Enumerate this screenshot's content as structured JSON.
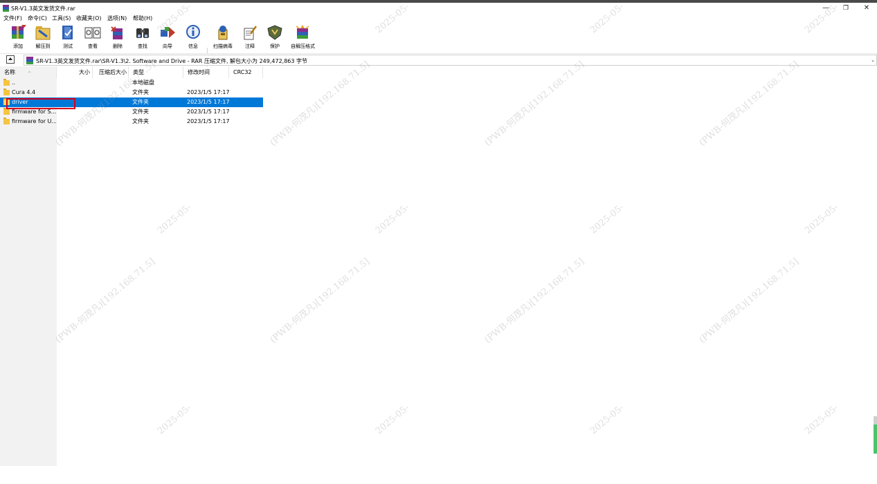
{
  "window": {
    "title": "SR-V1.3英文发货文件.rar",
    "controls": {
      "minimize": "—",
      "maximize": "❐",
      "close": "✕"
    }
  },
  "menu": {
    "items": [
      "文件(F)",
      "命令(C)",
      "工具(S)",
      "收藏夹(O)",
      "选项(N)",
      "帮助(H)"
    ]
  },
  "toolbar": {
    "buttons": [
      {
        "label": "添加",
        "icon": "add-archive-icon"
      },
      {
        "label": "解压到",
        "icon": "extract-to-icon"
      },
      {
        "label": "测试",
        "icon": "test-icon"
      },
      {
        "label": "查看",
        "icon": "view-icon"
      },
      {
        "label": "删除",
        "icon": "delete-icon"
      },
      {
        "label": "查找",
        "icon": "find-icon"
      },
      {
        "label": "向导",
        "icon": "wizard-icon"
      },
      {
        "label": "信息",
        "icon": "info-icon"
      },
      {
        "label": "扫描病毒",
        "icon": "virus-scan-icon"
      },
      {
        "label": "注释",
        "icon": "comment-icon"
      },
      {
        "label": "保护",
        "icon": "protect-icon"
      },
      {
        "label": "自解压格式",
        "icon": "sfx-icon"
      }
    ]
  },
  "address": {
    "path": "SR-V1.3英文发货文件.rar\\SR-V1.3\\2. Software and Drive - RAR 压缩文件, 解包大小为 249,472,863 字节"
  },
  "columns": {
    "name": "名称",
    "size": "大小",
    "packed": "压缩后大小",
    "type": "类型",
    "modified": "修改时间",
    "crc": "CRC32"
  },
  "rows": [
    {
      "name": "..",
      "type": "本地磁盘",
      "modified": "",
      "selected": false
    },
    {
      "name": "Cura 4.4",
      "type": "文件夹",
      "modified": "2023/1/5 17:17",
      "selected": false
    },
    {
      "name": "driver",
      "type": "文件夹",
      "modified": "2023/1/5 17:17",
      "selected": true
    },
    {
      "name": "firmware for S...",
      "type": "文件夹",
      "modified": "2023/1/5 17:17",
      "selected": false
    },
    {
      "name": "firmware for U...",
      "type": "文件夹",
      "modified": "2023/1/5 17:17",
      "selected": false
    }
  ],
  "watermark": {
    "a": "(PWB-何茂凡)[192.168.71.5]",
    "b": "2025-05-"
  },
  "colors": {
    "selection": "#0078d7",
    "highlight_box": "#d9001b",
    "folder": "#f5c541"
  }
}
